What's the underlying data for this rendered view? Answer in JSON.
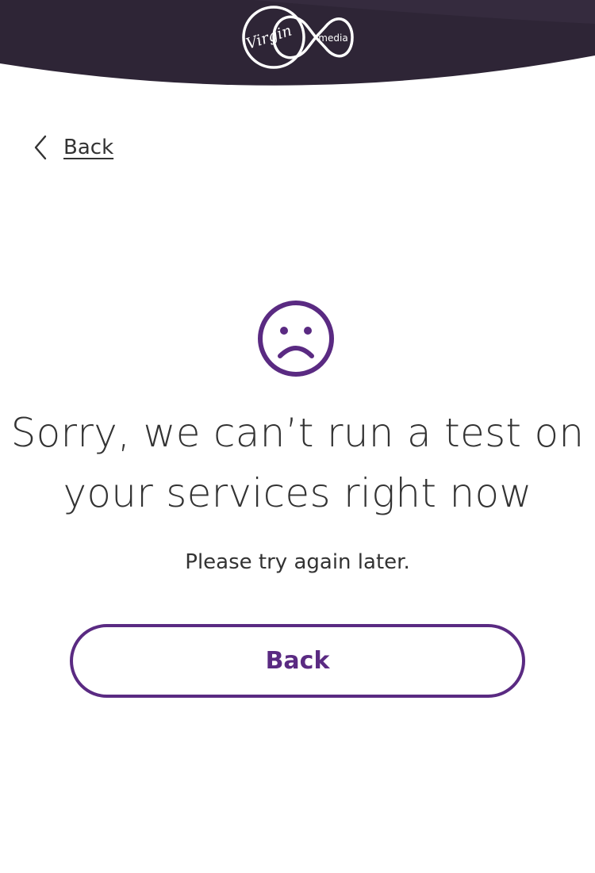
{
  "header": {
    "brand_name": "Virgin media",
    "logo_icon": "virgin-media-logo-icon",
    "background_color": "#2e2536"
  },
  "nav": {
    "back_label": "Back",
    "back_icon": "chevron-left-icon"
  },
  "main": {
    "status_icon": "sad-face-icon",
    "title": "Sorry, we can’t run a test on your services right now",
    "subtitle": "Please try again later.",
    "back_button_label": "Back"
  },
  "colors": {
    "accent": "#5a2a82",
    "text": "#333333",
    "background": "#ffffff"
  }
}
